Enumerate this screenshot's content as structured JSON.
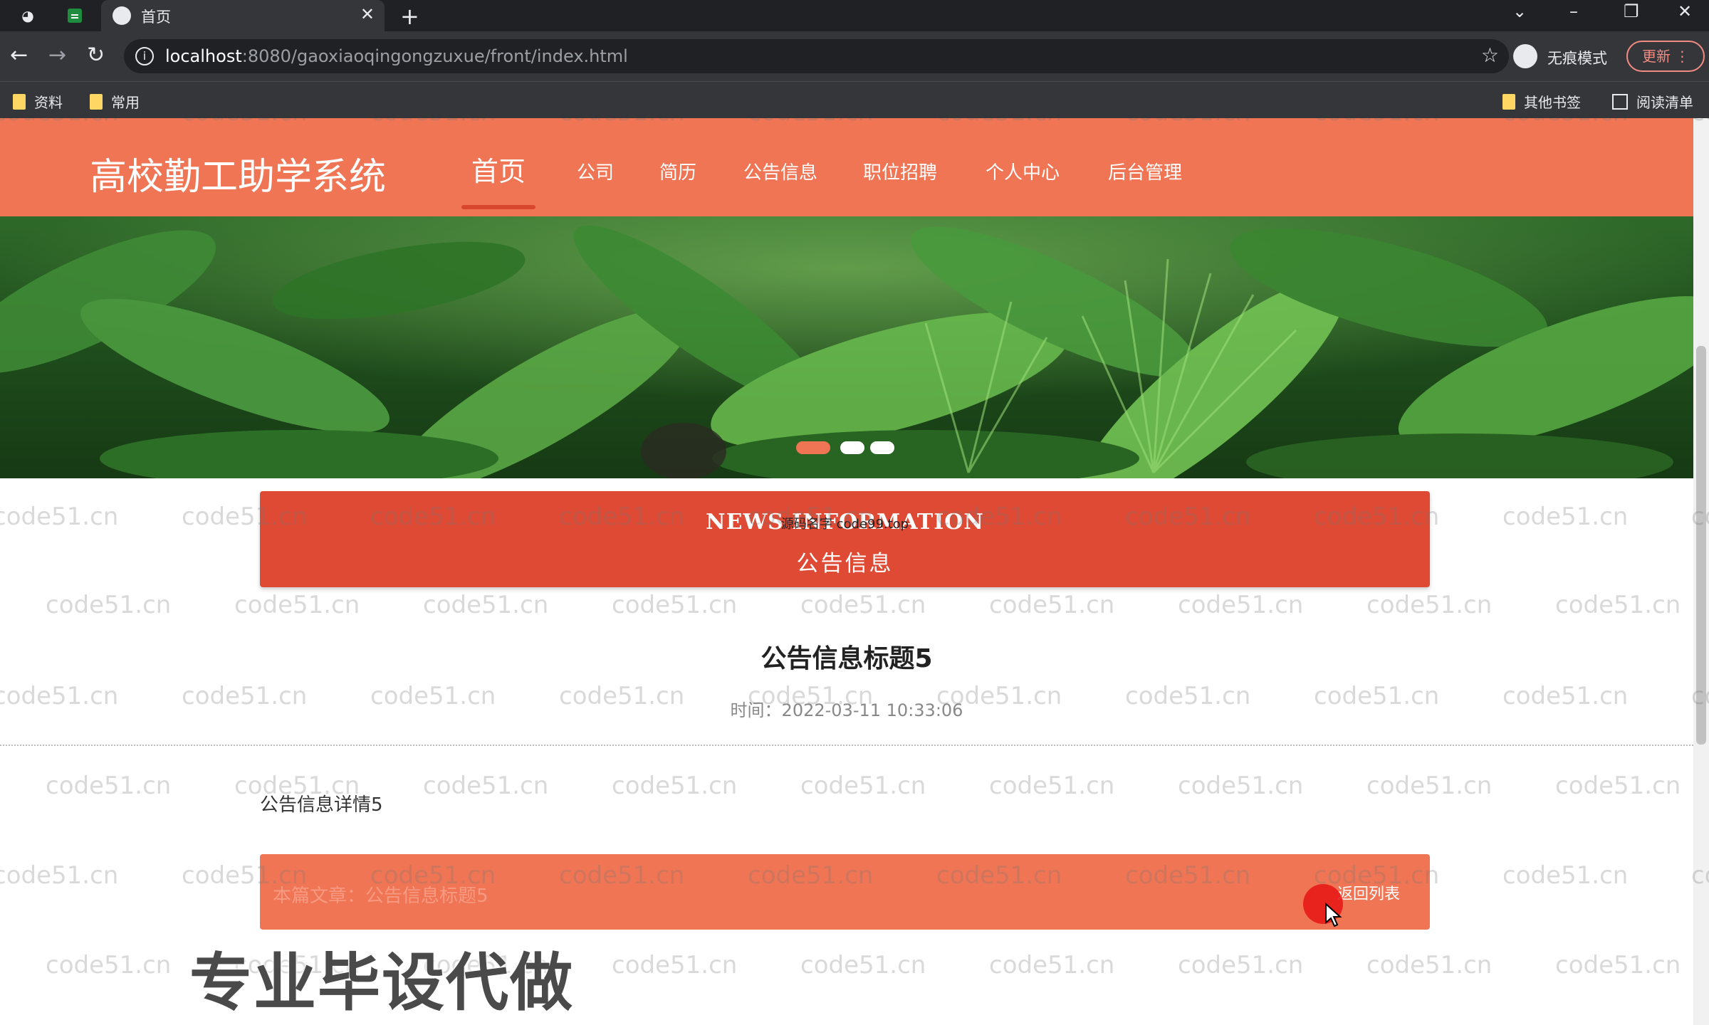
{
  "browser": {
    "tab_title": "首页",
    "url_host": "localhost",
    "url_rest": ":8080/gaoxiaoqingongzuxue/front/index.html",
    "incognito_label": "无痕模式",
    "update_label": "更新",
    "bookmarks": [
      {
        "label": "资料"
      },
      {
        "label": "常用"
      }
    ],
    "other_bookmarks": "其他书签",
    "reading_list": "阅读清单"
  },
  "site": {
    "title": "高校勤工助学系统",
    "nav": [
      {
        "label": "首页"
      },
      {
        "label": "公司"
      },
      {
        "label": "简历"
      },
      {
        "label": "公告信息"
      },
      {
        "label": "职位招聘"
      },
      {
        "label": "个人中心"
      },
      {
        "label": "后台管理"
      }
    ]
  },
  "section": {
    "en": "NEWS INFORMATION",
    "cn": "公告信息",
    "overlay": "源码名字 code99.top"
  },
  "article": {
    "title": "公告信息标题5",
    "time": "时间：2022-03-11 10:33:06",
    "body": "公告信息详情5"
  },
  "footer": {
    "current": "本篇文章：公告信息标题5",
    "back": "返回列表"
  },
  "promo": "专业毕设代做",
  "watermark": "code51.cn",
  "colors": {
    "header": "#f07555",
    "section": "#de4a34",
    "dot_active": "#f07555"
  }
}
